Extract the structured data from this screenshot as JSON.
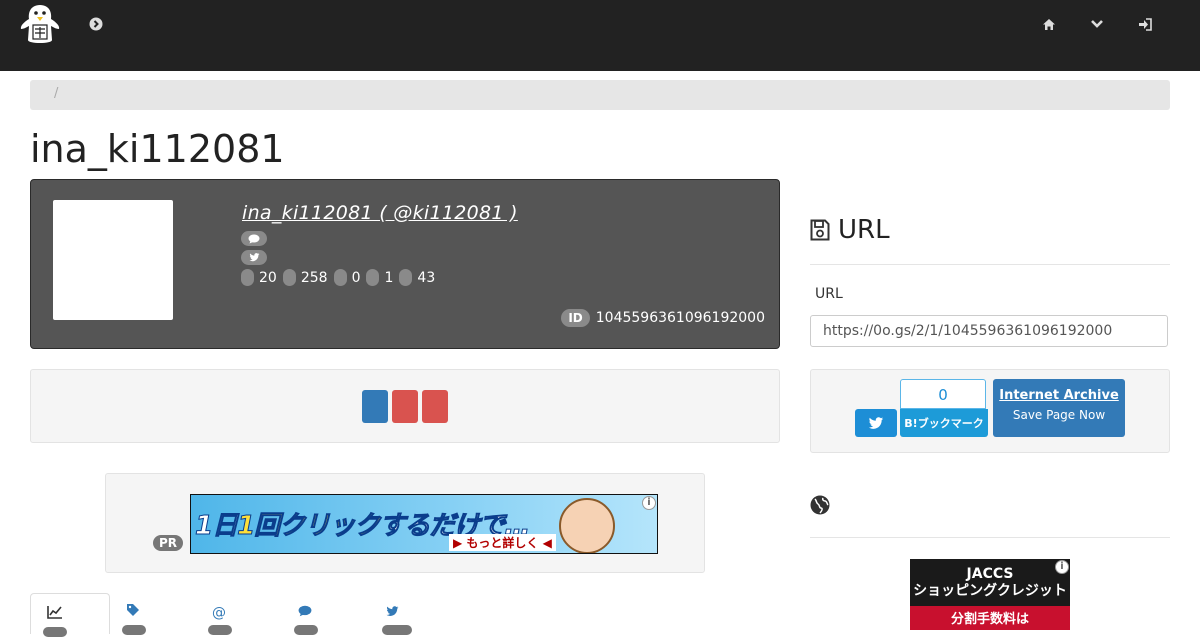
{
  "page": {
    "title": "ina_ki112081",
    "breadcrumb_sep": "/"
  },
  "profile": {
    "display": "ina_ki112081 ( @ki112081 )",
    "stats": [
      20,
      258,
      0,
      1,
      43
    ],
    "id_label": "ID",
    "id_value": "1045596361096192000"
  },
  "url_panel": {
    "title": "URL",
    "label": "URL",
    "value": "https://0o.gs/2/1/1045596361096192000"
  },
  "social": {
    "hatena_count": "0",
    "hatena_label": "B!ブックマーク",
    "archive_title": "Internet Archive",
    "archive_sub": "Save Page Now"
  },
  "ads": {
    "pr_label": "PR",
    "banner1_main_a": "1日",
    "banner1_main_b": "1回",
    "banner1_main_c": "クリック",
    "banner1_main_d": "するだけで…",
    "banner1_sub": "▶ もっと詳しく ◀",
    "banner2_brand_1": "JACCS",
    "banner2_brand_2": "ショッピングクレジット",
    "banner2_sub": "分割手数料は"
  },
  "colors": {
    "navbar": "#222222",
    "profile_bg": "#555555",
    "twitter_blue": "#1d8ed6",
    "share_blue": "#337ab7",
    "share_red": "#d9534f"
  },
  "icons": [
    "logo-icon",
    "chevron-circle-right-icon",
    "home-icon",
    "chevron-down-icon",
    "sign-in-icon",
    "comment-icon",
    "twitter-icon",
    "floppy-disk-icon",
    "globe-icon",
    "line-chart-icon",
    "tag-icon",
    "at-icon",
    "info-icon"
  ]
}
